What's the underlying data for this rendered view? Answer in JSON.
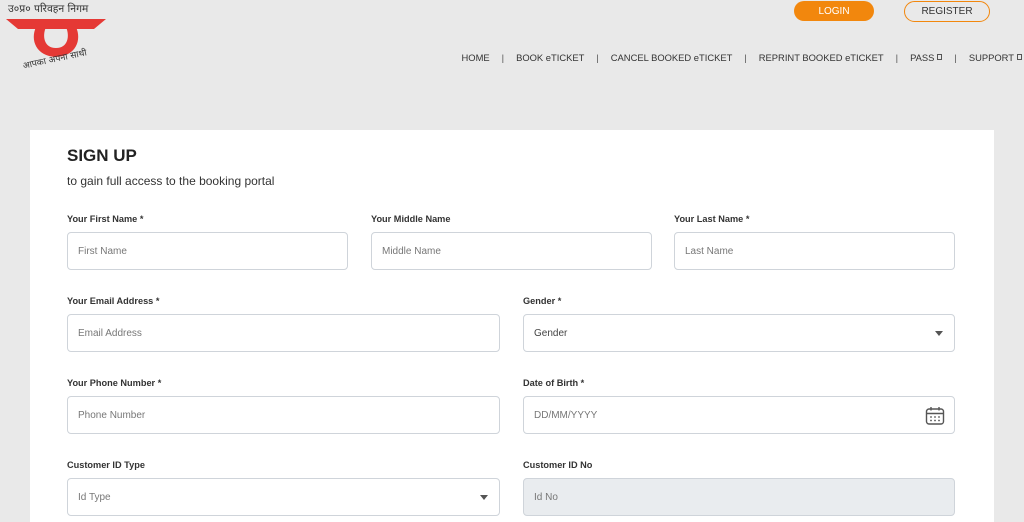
{
  "logo": {
    "top_text": "उ०प्र० परिवहन निगम",
    "tagline": "आपका अपना साथी",
    "brand_red": "#e53935"
  },
  "header": {
    "login_label": "LOGIN",
    "register_label": "REGISTER",
    "accent_color": "#f2870d"
  },
  "nav": {
    "items": [
      {
        "label": "HOME"
      },
      {
        "label": "BOOK eTICKET"
      },
      {
        "label": "CANCEL BOOKED eTICKET"
      },
      {
        "label": "REPRINT BOOKED eTICKET"
      },
      {
        "label": "PASS"
      },
      {
        "label": "SUPPORT"
      }
    ],
    "separator": "|"
  },
  "form": {
    "title": "SIGN UP",
    "subtitle": "to gain full access to the booking portal",
    "first_name": {
      "label": "Your First Name *",
      "placeholder": "First Name"
    },
    "middle_name": {
      "label": "Your Middle Name",
      "placeholder": "Middle Name"
    },
    "last_name": {
      "label": "Your Last Name *",
      "placeholder": "Last Name"
    },
    "email": {
      "label": "Your Email Address *",
      "placeholder": "Email Address"
    },
    "gender": {
      "label": "Gender *",
      "value": "Gender"
    },
    "phone": {
      "label": "Your Phone Number *",
      "placeholder": "Phone Number"
    },
    "dob": {
      "label": "Date of Birth *",
      "placeholder": "DD/MM/YYYY"
    },
    "id_type": {
      "label": "Customer ID Type",
      "value": "Id Type"
    },
    "id_no": {
      "label": "Customer ID No",
      "placeholder": "Id No"
    }
  }
}
